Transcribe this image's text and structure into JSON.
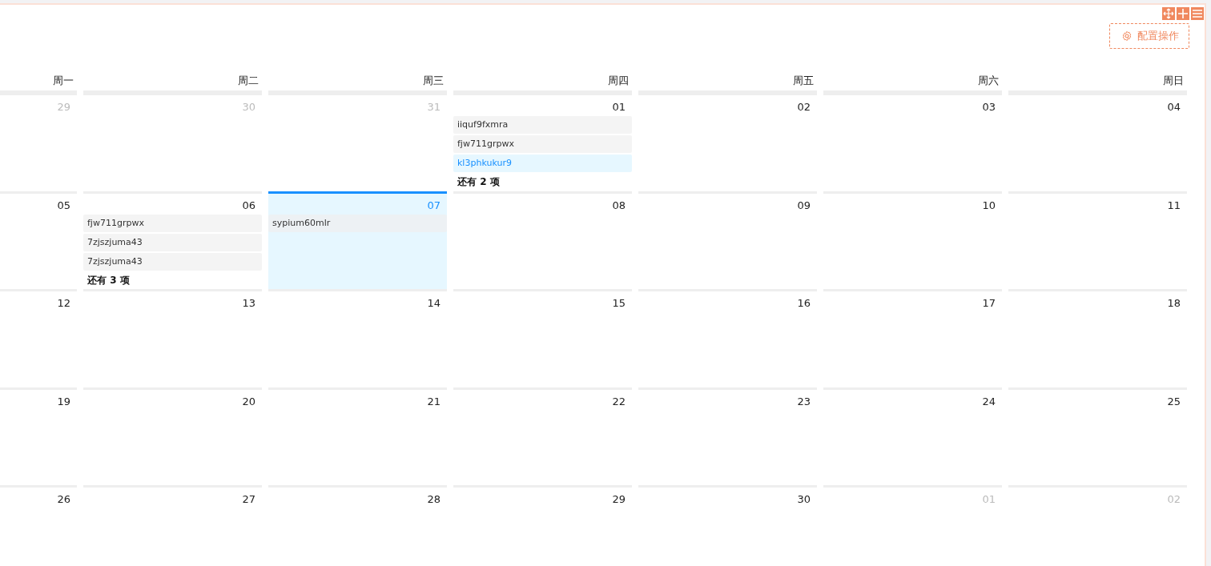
{
  "toolbar": {
    "button": "配置操作"
  },
  "weekdays": [
    "周一",
    "周二",
    "周三",
    "周四",
    "周五",
    "周六",
    "周日"
  ],
  "weeks": [
    {
      "days": [
        {
          "date": "29",
          "other_month": true,
          "today": false
        },
        {
          "date": "30",
          "other_month": true,
          "today": false
        },
        {
          "date": "31",
          "other_month": true,
          "today": false
        },
        {
          "date": "01",
          "other_month": false,
          "today": false,
          "events": [
            {
              "title": "iiquf9fxmra",
              "selected": false
            },
            {
              "title": "fjw711grpwx",
              "selected": false
            },
            {
              "title": "kl3phkukur9",
              "selected": true
            }
          ],
          "more": "还有 2 项"
        },
        {
          "date": "02",
          "other_month": false,
          "today": false
        },
        {
          "date": "03",
          "other_month": false,
          "today": false
        },
        {
          "date": "04",
          "other_month": false,
          "today": false
        }
      ]
    },
    {
      "days": [
        {
          "date": "05",
          "other_month": false,
          "today": false
        },
        {
          "date": "06",
          "other_month": false,
          "today": false,
          "events": [
            {
              "title": "fjw711grpwx",
              "selected": false
            },
            {
              "title": "7zjszjuma43",
              "selected": false
            },
            {
              "title": "7zjszjuma43",
              "selected": false
            }
          ],
          "more": "还有 3 项"
        },
        {
          "date": "07",
          "other_month": false,
          "today": true,
          "events": [
            {
              "title": "sypium60mlr",
              "selected": false
            }
          ]
        },
        {
          "date": "08",
          "other_month": false,
          "today": false
        },
        {
          "date": "09",
          "other_month": false,
          "today": false
        },
        {
          "date": "10",
          "other_month": false,
          "today": false
        },
        {
          "date": "11",
          "other_month": false,
          "today": false
        }
      ]
    },
    {
      "days": [
        {
          "date": "12",
          "other_month": false,
          "today": false
        },
        {
          "date": "13",
          "other_month": false,
          "today": false
        },
        {
          "date": "14",
          "other_month": false,
          "today": false
        },
        {
          "date": "15",
          "other_month": false,
          "today": false
        },
        {
          "date": "16",
          "other_month": false,
          "today": false
        },
        {
          "date": "17",
          "other_month": false,
          "today": false
        },
        {
          "date": "18",
          "other_month": false,
          "today": false
        }
      ]
    },
    {
      "days": [
        {
          "date": "19",
          "other_month": false,
          "today": false
        },
        {
          "date": "20",
          "other_month": false,
          "today": false
        },
        {
          "date": "21",
          "other_month": false,
          "today": false
        },
        {
          "date": "22",
          "other_month": false,
          "today": false
        },
        {
          "date": "23",
          "other_month": false,
          "today": false
        },
        {
          "date": "24",
          "other_month": false,
          "today": false
        },
        {
          "date": "25",
          "other_month": false,
          "today": false
        }
      ]
    },
    {
      "days": [
        {
          "date": "26",
          "other_month": false,
          "today": false
        },
        {
          "date": "27",
          "other_month": false,
          "today": false
        },
        {
          "date": "28",
          "other_month": false,
          "today": false
        },
        {
          "date": "29",
          "other_month": false,
          "today": false
        },
        {
          "date": "30",
          "other_month": false,
          "today": false
        },
        {
          "date": "01",
          "other_month": true,
          "today": false
        },
        {
          "date": "02",
          "other_month": true,
          "today": false
        }
      ]
    }
  ]
}
